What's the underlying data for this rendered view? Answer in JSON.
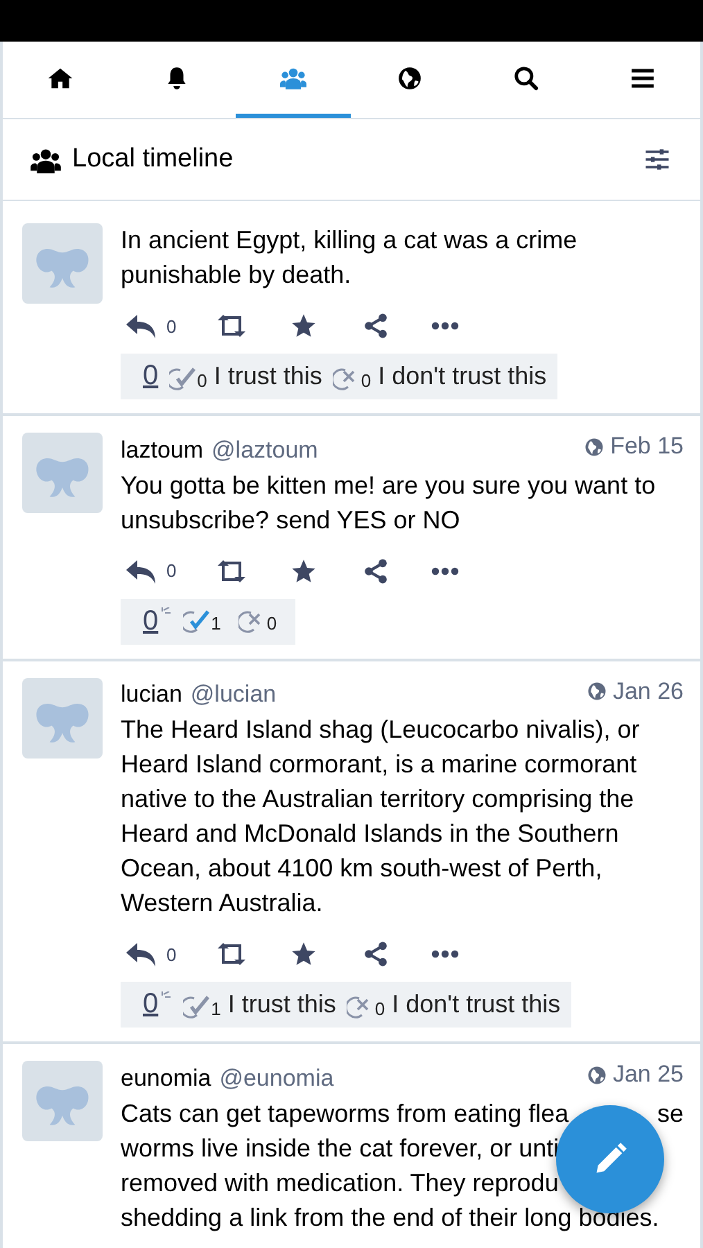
{
  "nav_tabs": [
    {
      "selected": false
    },
    {
      "selected": false
    },
    {
      "selected": true
    },
    {
      "selected": false
    },
    {
      "selected": false
    },
    {
      "selected": false
    }
  ],
  "column": {
    "title": "Local timeline"
  },
  "posts": [
    {
      "body": "In ancient Egypt, killing a cat was a crime punishable by death.",
      "replies": "0",
      "trust": {
        "score": "0",
        "score_new": false,
        "trust_count": "0",
        "trust_selected": false,
        "trust_label": "I trust this",
        "distrust_count": "0",
        "distrust_label": "I don't trust this"
      }
    },
    {
      "name": "laztoum",
      "handle": "@laztoum",
      "date": "Feb 15",
      "body": "You gotta be kitten me! are you sure you want to unsubscribe? send YES or NO",
      "replies": "0",
      "trust": {
        "score": "0",
        "score_new": true,
        "trust_count": "1",
        "trust_selected": true,
        "distrust_count": "0"
      }
    },
    {
      "name": "lucian",
      "handle": "@lucian",
      "date": "Jan 26",
      "body": "The Heard Island shag (Leucocarbo nivalis), or Heard Island cormorant, is a marine cormorant native to the Australian territory comprising the Heard and McDonald Islands in the Southern Ocean, about 4100 km south-west of Perth, Western Australia.",
      "replies": "0",
      "trust": {
        "score": "0",
        "score_new": true,
        "trust_count": "1",
        "trust_selected": false,
        "trust_label": "I trust this",
        "distrust_count": "0",
        "distrust_label": "I don't trust this"
      }
    },
    {
      "name": "eunomia",
      "handle": "@eunomia",
      "date": "Jan 25",
      "body_lines": [
        {
          "text": "Cats can get tapeworms from eating flea",
          "tail": "se"
        },
        {
          "text": "worms live inside the cat forever, or unti"
        },
        {
          "text": "removed with medication. They reprodu"
        },
        {
          "text": "shedding a link from the end of their long bodies."
        }
      ]
    }
  ]
}
